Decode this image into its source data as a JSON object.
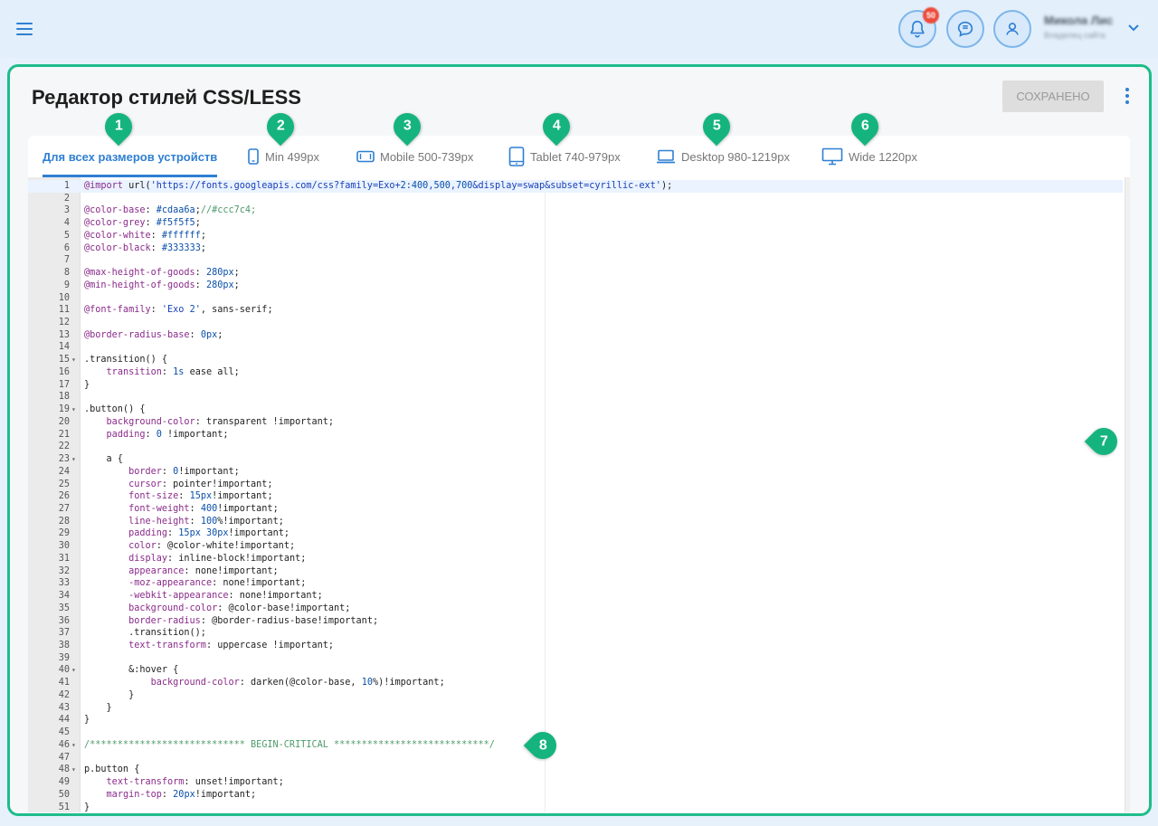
{
  "header": {
    "notification_count": "50",
    "user_name": "Микола Лис",
    "user_role": "Владелец сайта",
    "accent_color": "#2f7fd2"
  },
  "page": {
    "title": "Редактор стилей CSS/LESS",
    "save_label": "СОХРАНЕНО"
  },
  "tabs": [
    {
      "label": "Для всех размеров устройств",
      "icon": "none",
      "active": true
    },
    {
      "label": "Min 499px",
      "icon": "phone-icon"
    },
    {
      "label": "Mobile 500-739px",
      "icon": "mobile-landscape-icon"
    },
    {
      "label": "Tablet 740-979px",
      "icon": "tablet-icon"
    },
    {
      "label": "Desktop 980-1219px",
      "icon": "laptop-icon"
    },
    {
      "label": "Wide 1220px",
      "icon": "monitor-icon"
    }
  ],
  "markers": [
    "1",
    "2",
    "3",
    "4",
    "5",
    "6",
    "7",
    "8"
  ],
  "editor": {
    "lines": [
      "@import url('https://fonts.googleapis.com/css?family=Exo+2:400,500,700&display=swap&subset=cyrillic-ext');",
      "",
      "@color-base: #cdaa6a;//#ccc7c4;",
      "@color-grey: #f5f5f5;",
      "@color-white: #ffffff;",
      "@color-black: #333333;",
      "",
      "@max-height-of-goods: 280px;",
      "@min-height-of-goods: 280px;",
      "",
      "@font-family: 'Exo 2', sans-serif;",
      "",
      "@border-radius-base: 0px;",
      "",
      ".transition() {",
      "    transition: 1s ease all;",
      "}",
      "",
      ".button() {",
      "    background-color: transparent !important;",
      "    padding: 0 !important;",
      "",
      "    a {",
      "        border: 0!important;",
      "        cursor: pointer!important;",
      "        font-size: 15px!important;",
      "        font-weight: 400!important;",
      "        line-height: 100%!important;",
      "        padding: 15px 30px!important;",
      "        color: @color-white!important;",
      "        display: inline-block!important;",
      "        appearance: none!important;",
      "        -moz-appearance: none!important;",
      "        -webkit-appearance: none!important;",
      "        background-color: @color-base!important;",
      "        border-radius: @border-radius-base!important;",
      "        .transition();",
      "        text-transform: uppercase !important;",
      "",
      "        &:hover {",
      "            background-color: darken(@color-base, 10%)!important;",
      "        }",
      "    }",
      "}",
      "",
      "/**************************** BEGIN-CRITICAL ****************************/",
      "",
      "p.button {",
      "    text-transform: unset!important;",
      "    margin-top: 20px!important;",
      "}"
    ],
    "fold_lines": [
      15,
      19,
      23,
      40,
      46,
      48
    ]
  }
}
